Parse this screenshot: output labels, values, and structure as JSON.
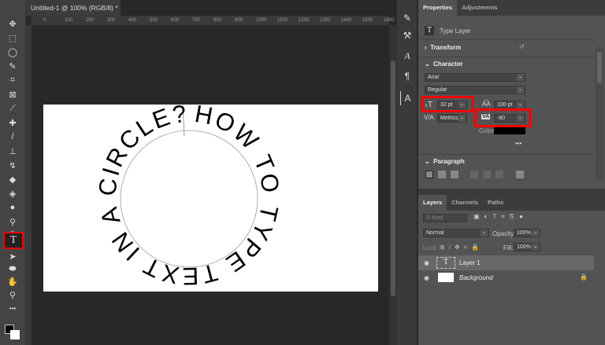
{
  "document": {
    "tab_title": "Untitled-1 @ 100% (RGB/8) *",
    "close": "×",
    "ruler_ticks": [
      "0",
      "100",
      "200",
      "300",
      "400",
      "500",
      "600",
      "700",
      "800",
      "900",
      "1000",
      "1100",
      "1200",
      "1300",
      "1400",
      "1500",
      "1600"
    ]
  },
  "canvas": {
    "curved_text": "HOW TO TYPE TEXT IN A CIRCLE? ",
    "text_color": "#000000",
    "background": "#ffffff"
  },
  "tools": [
    "move-tool",
    "marquee-tool",
    "lasso-tool",
    "quick-select-tool",
    "crop-tool",
    "frame-tool",
    "eyedropper-tool",
    "healing-brush-tool",
    "brush-tool",
    "clone-stamp-tool",
    "history-brush-tool",
    "eraser-tool",
    "paint-bucket-tool",
    "blur-tool",
    "dodge-tool",
    "pen-tool",
    "type-tool",
    "path-selection-tool",
    "ellipse-tool",
    "hand-tool",
    "zoom-tool",
    "more-tools"
  ],
  "toolbar": {
    "selected_tool": "type-tool",
    "type_glyph": "T",
    "more": "•••"
  },
  "properties": {
    "tabs": [
      "Properties",
      "Adjustments"
    ],
    "layer_type": "Type Layer",
    "transform": "Transform",
    "character": "Character",
    "font_family": "Arial",
    "font_style": "Regular",
    "font_size": "32 pt",
    "leading": "100 pt",
    "kerning": "Metrics",
    "tracking": "-80",
    "color_label": "Color",
    "color_value": "#000000",
    "more": "•••",
    "paragraph": "Paragraph"
  },
  "layers": {
    "tabs": [
      "Layers",
      "Channels",
      "Paths"
    ],
    "filter_placeholder": "Kind",
    "blend_mode": "Normal",
    "opacity_label": "Opacity:",
    "opacity": "100%",
    "lock_label": "Lock:",
    "fill_label": "Fill:",
    "fill": "100%",
    "items": [
      {
        "name": "Layer 1",
        "glyph": "T"
      },
      {
        "name": "Background"
      }
    ]
  }
}
